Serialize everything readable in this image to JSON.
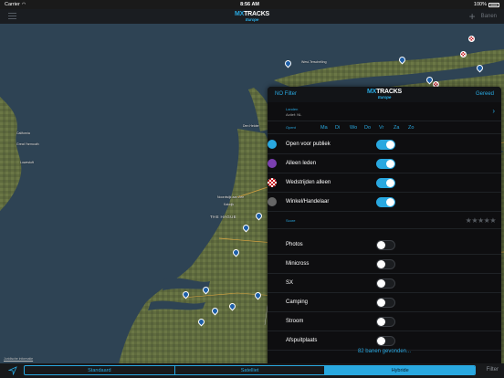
{
  "status": {
    "carrier": "Carrier",
    "time": "8:56 AM",
    "battery": "100%"
  },
  "nav": {
    "logo_main": "MX",
    "logo_tracks": "TRACKS",
    "logo_sub": "Europe",
    "banen_label": "Banen"
  },
  "map": {
    "labels": {
      "california": "California",
      "great_yarmouth": "Great Yarmouth",
      "lowestoft": "Lowestoft",
      "the_hague": "THE HAGUE",
      "den_helder": "Den Helder",
      "noordwijk": "Noordwijk aan Zee",
      "katwijk": "Katwijk",
      "west_terschelling": "West-Terschelling"
    },
    "legal": "Juridische informatie"
  },
  "panel": {
    "left_button": "NO Filter",
    "right_button": "Gereed",
    "logo_main": "MX",
    "logo_tracks": "TRACKS",
    "logo_sub": "Europe",
    "landen_title": "Landen",
    "landen_value": "Actief: NL",
    "open_title": "Opent",
    "days": [
      "Ma",
      "Di",
      "Wo",
      "Do",
      "Vr",
      "Za",
      "Zo"
    ],
    "options_top": [
      {
        "label": "Open voor publiek",
        "on": true,
        "icon": "motocross-icon",
        "color": "#29a8e0"
      },
      {
        "label": "Alleen leden",
        "on": true,
        "icon": "club-icon",
        "color": "#7b3fb0"
      },
      {
        "label": "Wedstrijden alleen",
        "on": true,
        "icon": "race-flag-icon",
        "color": "#c4151c"
      },
      {
        "label": "Winkel/Handelaar",
        "on": true,
        "icon": "wrench-icon",
        "color": "#666666"
      }
    ],
    "score_title": "Score",
    "options_bottom": [
      {
        "label": "Photos",
        "on": false
      },
      {
        "label": "Minicross",
        "on": false
      },
      {
        "label": "SX",
        "on": false
      },
      {
        "label": "Camping",
        "on": false
      },
      {
        "label": "Stroom",
        "on": false
      },
      {
        "label": "Afspuitplaats",
        "on": false
      }
    ],
    "found_text": "82 banen gevonden..."
  },
  "tabbar": {
    "segments": [
      "Standaard",
      "Satelliet",
      "Hybride"
    ],
    "selected": "Hybride",
    "filter_label": "Filter"
  },
  "colors": {
    "accent": "#29a8e0"
  }
}
